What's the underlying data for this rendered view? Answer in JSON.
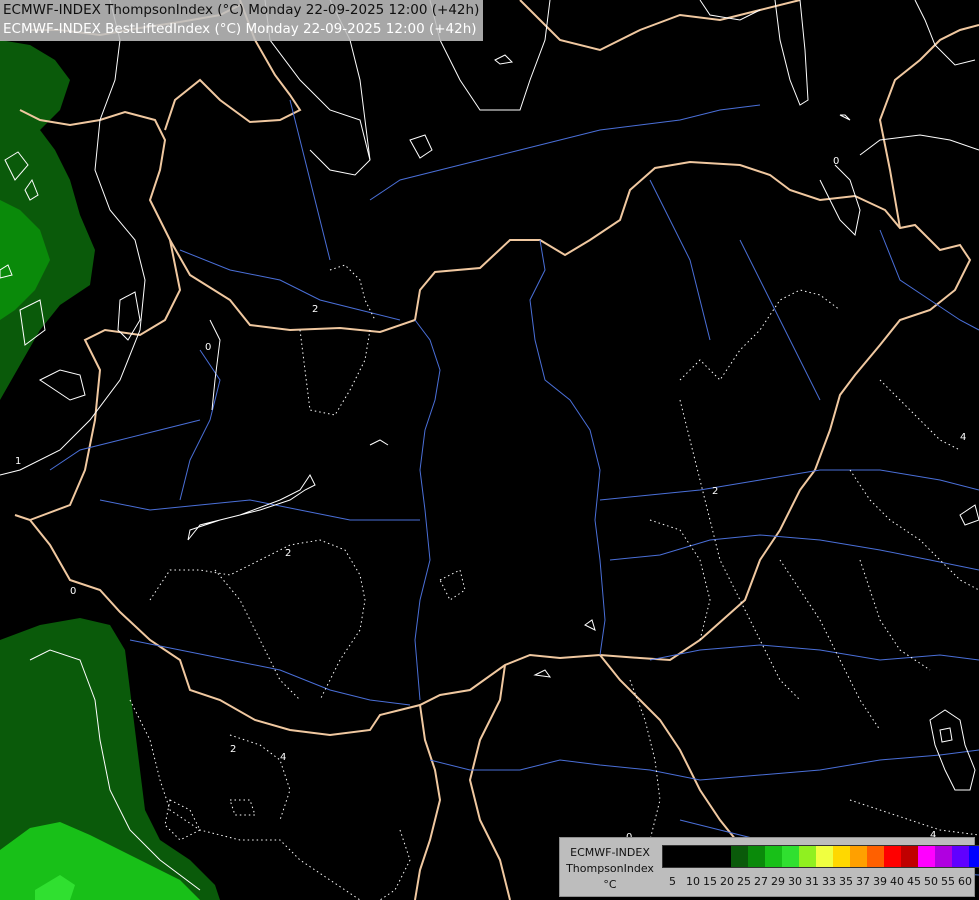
{
  "title": {
    "line1": "ECMWF-INDEX ThompsonIndex (°C) Monday 22-09-2025 12:00 (+42h)",
    "line2": "ECMWF-INDEX BestLiftedIndex (°C) Monday 22-09-2025 12:00 (+42h)"
  },
  "legend": {
    "model": "ECMWF-INDEX",
    "parameter": "ThompsonIndex",
    "unit": "°C",
    "ticks": [
      "5",
      "10",
      "15",
      "20",
      "25",
      "27",
      "29",
      "30",
      "31",
      "33",
      "35",
      "37",
      "39",
      "40",
      "45",
      "50",
      "55",
      "60"
    ],
    "colors": [
      "#000000",
      "#000000",
      "#000000",
      "#000000",
      "#0a5a0a",
      "#0a8a0a",
      "#18c018",
      "#30e030",
      "#90f020",
      "#f0ff40",
      "#ffd800",
      "#ffa000",
      "#ff6000",
      "#ff0000",
      "#c00000",
      "#ff00ff",
      "#b000e0",
      "#6000ff",
      "#0000ff"
    ]
  },
  "map": {
    "background": "#000000",
    "border_color": "#f0c8a0",
    "river_color": "#4a6fd8",
    "contour_color": "#ffffff",
    "contour_labels": [
      "2",
      "0",
      "2",
      "2",
      "0",
      "1",
      "2",
      "4",
      "0",
      "4",
      "4",
      "0"
    ]
  }
}
